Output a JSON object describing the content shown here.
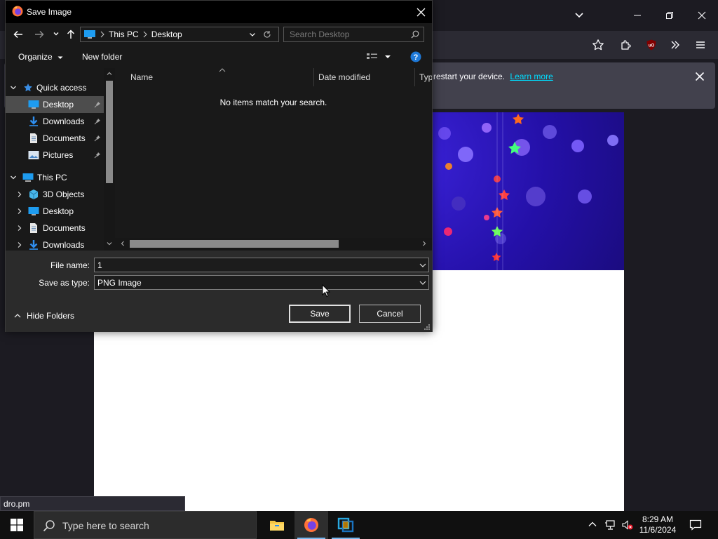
{
  "firefox": {
    "notification": {
      "text": "restart your device.",
      "link": "Learn more"
    },
    "status_url": "dro.pm"
  },
  "dialog": {
    "title": "Save Image",
    "breadcrumb": [
      "This PC",
      "Desktop"
    ],
    "search_placeholder": "Search Desktop",
    "organize_label": "Organize",
    "new_folder_label": "New folder",
    "tree": {
      "quick_access": "Quick access",
      "quick_items": [
        "Desktop",
        "Downloads",
        "Documents",
        "Pictures"
      ],
      "this_pc": "This PC",
      "pc_items": [
        "3D Objects",
        "Desktop",
        "Documents",
        "Downloads"
      ]
    },
    "columns": [
      "Name",
      "Date modified",
      "Type"
    ],
    "empty_message": "No items match your search.",
    "file_name_label": "File name:",
    "file_name_value": "1",
    "save_type_label": "Save as type:",
    "save_type_value": "PNG Image",
    "hide_folders_label": "Hide Folders",
    "save_label": "Save",
    "cancel_label": "Cancel"
  },
  "taskbar": {
    "search_placeholder": "Type here to search",
    "time": "8:29 AM",
    "date": "11/6/2024"
  },
  "colors": {
    "firefox_bg": "#1c1b22",
    "link": "#00ddff",
    "selection": "#4d4d4d",
    "taskbar": "#101010"
  }
}
